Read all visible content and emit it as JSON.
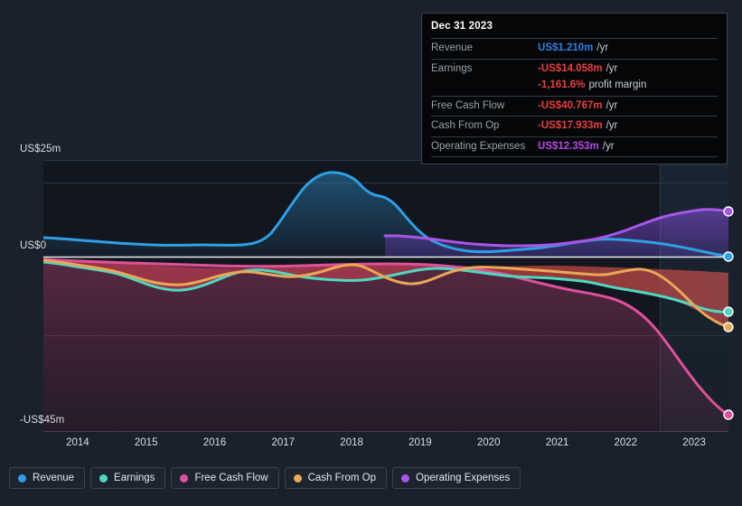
{
  "chart_data": {
    "type": "area",
    "title": "",
    "xlabel": "",
    "ylabel": "",
    "ylim": [
      -45,
      25
    ],
    "grid": true,
    "legend_position": "bottom-left",
    "y_ticks": [
      "US$25m",
      "US$0",
      "-US$45m"
    ],
    "y_tick_values": [
      25,
      0,
      -45
    ],
    "categories": [
      "2014",
      "2015",
      "2016",
      "2017",
      "2018",
      "2019",
      "2020",
      "2021",
      "2022",
      "2023"
    ],
    "x": [
      2014,
      2015,
      2016,
      2017,
      2018,
      2019,
      2020,
      2021,
      2022,
      2023
    ],
    "units": "US$ millions per year",
    "series": [
      {
        "name": "Revenue",
        "color": "#2f9fe3",
        "values": [
          2.4,
          2.0,
          1.6,
          1.8,
          14.6,
          13.0,
          3.1,
          2.6,
          3.4,
          1.21
        ]
      },
      {
        "name": "Earnings",
        "color": "#4fd8c0",
        "values": [
          -2.6,
          -5.6,
          -6.5,
          -5.3,
          -9.8,
          -4.6,
          -4.0,
          -5.2,
          -8.6,
          -14.058
        ]
      },
      {
        "name": "Free Cash Flow",
        "color": "#e0509a",
        "values": [
          -0.5,
          -0.6,
          -0.7,
          -0.5,
          -0.6,
          -1.0,
          -2.2,
          -6.5,
          -16.0,
          -40.767
        ]
      },
      {
        "name": "Cash From Op",
        "color": "#e8a855",
        "values": [
          -1.0,
          -4.2,
          -5.0,
          -3.6,
          -6.6,
          -2.6,
          -1.6,
          -3.4,
          -7.4,
          -17.933
        ]
      },
      {
        "name": "Operating Expenses",
        "color": "#a855e8",
        "values": [
          null,
          null,
          null,
          null,
          null,
          5.3,
          4.5,
          5.4,
          7.6,
          12.353
        ]
      }
    ]
  },
  "axis": {
    "y_top_label": "US$25m",
    "y_zero_label": "US$0",
    "y_bottom_label": "-US$45m",
    "x_ticks": [
      "2014",
      "2015",
      "2016",
      "2017",
      "2018",
      "2019",
      "2020",
      "2021",
      "2022",
      "2023"
    ]
  },
  "tooltip": {
    "date": "Dec 31 2023",
    "rows": [
      {
        "label": "Revenue",
        "value": "US$1.210m",
        "suffix": "/yr",
        "color": "#2f7fe3"
      },
      {
        "label": "Earnings",
        "value": "-US$14.058m",
        "suffix": "/yr",
        "color": "#e84040"
      },
      {
        "label": "",
        "value": "-1,161.6%",
        "suffix": "profit margin",
        "color": "#e84040"
      },
      {
        "label": "Free Cash Flow",
        "value": "-US$40.767m",
        "suffix": "/yr",
        "color": "#e84040"
      },
      {
        "label": "Cash From Op",
        "value": "-US$17.933m",
        "suffix": "/yr",
        "color": "#e84040"
      },
      {
        "label": "Operating Expenses",
        "value": "US$12.353m",
        "suffix": "/yr",
        "color": "#b44be8"
      }
    ]
  },
  "legend": {
    "items": [
      {
        "label": "Revenue",
        "color": "#2f9fe3"
      },
      {
        "label": "Earnings",
        "color": "#4fd8c0"
      },
      {
        "label": "Free Cash Flow",
        "color": "#e0509a"
      },
      {
        "label": "Cash From Op",
        "color": "#e8a855"
      },
      {
        "label": "Operating Expenses",
        "color": "#a855e8"
      }
    ]
  }
}
